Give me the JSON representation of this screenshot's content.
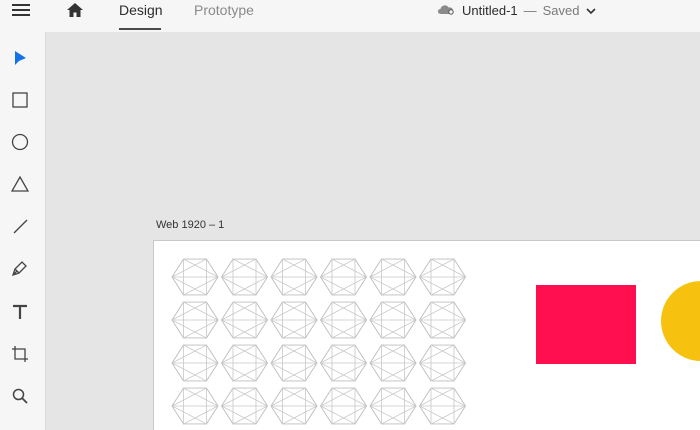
{
  "header": {
    "tabs": [
      {
        "label": "Design",
        "active": true
      },
      {
        "label": "Prototype",
        "active": false
      }
    ],
    "document_title": "Untitled-1",
    "separator": "—",
    "save_status": "Saved"
  },
  "toolbar": {
    "tools": [
      "select-tool",
      "rectangle-tool",
      "ellipse-tool",
      "triangle-tool",
      "line-tool",
      "pen-tool",
      "text-tool",
      "artboard-tool",
      "zoom-tool"
    ]
  },
  "canvas": {
    "artboard_label": "Web 1920 – 1",
    "shapes": {
      "rect_color": "#ff0f50",
      "circle_color": "#f6c20f"
    }
  },
  "colors": {
    "accent": "#1473e6",
    "topbar": "#f6f6f6",
    "canvas": "#e5e5e5"
  }
}
